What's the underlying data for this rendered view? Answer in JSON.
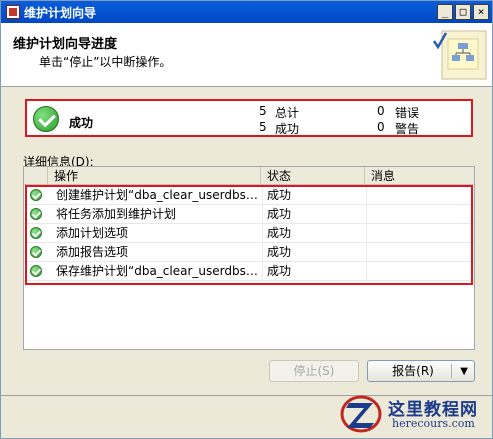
{
  "window": {
    "title": "维护计划向导",
    "controls": [
      "_",
      "□",
      "×"
    ]
  },
  "header": {
    "title": "维护计划向导进度",
    "subtitle": "单击“停止”以中断操作。"
  },
  "summary": {
    "status": "成功",
    "stats": [
      {
        "count": "5",
        "label": "总计"
      },
      {
        "count": "0",
        "label": "错误"
      },
      {
        "count": "5",
        "label": "成功"
      },
      {
        "count": "0",
        "label": "警告"
      }
    ]
  },
  "details": {
    "label": "详细信息(D):",
    "columns": [
      "操作",
      "状态",
      "消息"
    ],
    "rows": [
      {
        "action": "创建维护计划“dba_clear_userdbs_ba...",
        "status": "成功",
        "message": ""
      },
      {
        "action": "将任务添加到维护计划",
        "status": "成功",
        "message": ""
      },
      {
        "action": "添加计划选项",
        "status": "成功",
        "message": ""
      },
      {
        "action": "添加报告选项",
        "status": "成功",
        "message": ""
      },
      {
        "action": "保存维护计划“dba_clear_userdbs_ba...",
        "status": "成功",
        "message": ""
      }
    ]
  },
  "buttons": {
    "stop": "停止(S)",
    "report": "报告(R)",
    "report_caret": "▼"
  },
  "watermark": {
    "title": "这里教程网",
    "url": "herecours.com"
  },
  "colors": {
    "highlight": "#e0161d",
    "success": "#2e9b2e",
    "titlebar": "#0a5ddb"
  }
}
